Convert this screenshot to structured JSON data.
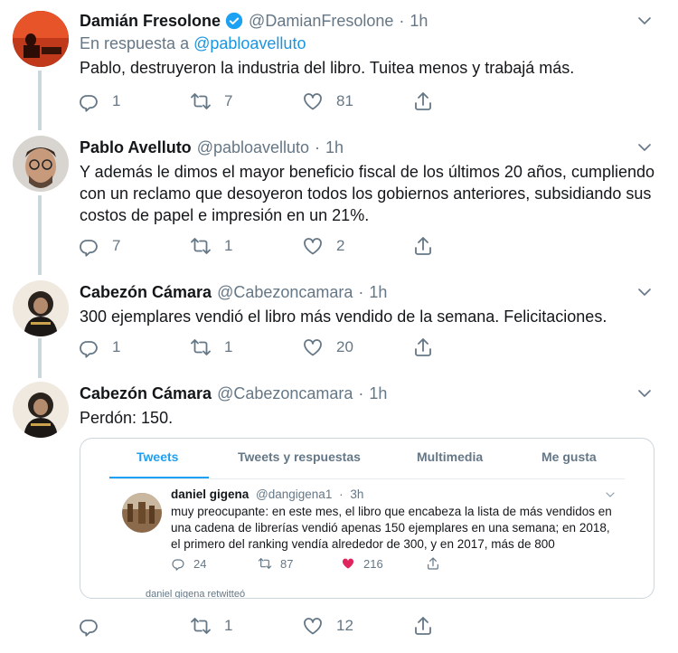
{
  "tweets": [
    {
      "name": "Damián Fresolone",
      "handle": "@DamianFresolone",
      "time": "1h",
      "reply_prefix": "En respuesta a",
      "reply_handle": "@pabloavelluto",
      "text": "Pablo, destruyeron la industria del libro. Tuitea menos y trabajá más.",
      "replies": "1",
      "retweets": "7",
      "likes": "81"
    },
    {
      "name": "Pablo Avelluto",
      "handle": "@pabloavelluto",
      "time": "1h",
      "text": "Y además le dimos el mayor beneficio fiscal de los últimos 20 años, cumpliendo con un reclamo que desoyeron todos los gobiernos anteriores, subsidiando sus costos de papel e impresión en un 21%.",
      "replies": "7",
      "retweets": "1",
      "likes": "2"
    },
    {
      "name": "Cabezón Cámara",
      "handle": "@Cabezoncamara",
      "time": "1h",
      "text": "300 ejemplares vendió el libro más vendido de la semana. Felicitaciones.",
      "replies": "1",
      "retweets": "1",
      "likes": "20"
    },
    {
      "name": "Cabezón Cámara",
      "handle": "@Cabezoncamara",
      "time": "1h",
      "text": "Perdón: 150.",
      "replies": "",
      "retweets": "1",
      "likes": "12"
    }
  ],
  "dot": "·",
  "embed": {
    "tabs": [
      "Tweets",
      "Tweets y respuestas",
      "Multimedia",
      "Me gusta"
    ],
    "name": "daniel gigena",
    "handle": "@dangigena1",
    "time": "3h",
    "text": "muy preocupante: en este mes, el libro que encabeza la lista de más vendidos en una cadena de librerías vendió apenas 150 ejemplares en una semana; en 2018, el primero del ranking vendía alrededor de 300, y en 2017, más de 800",
    "replies": "24",
    "retweets": "87",
    "likes": "216",
    "retweeted_note": "daniel gigena retwitteó"
  },
  "colors": {
    "accent": "#1da1f2",
    "link": "#1b95e0",
    "muted": "#657786",
    "like": "#e0245e"
  }
}
